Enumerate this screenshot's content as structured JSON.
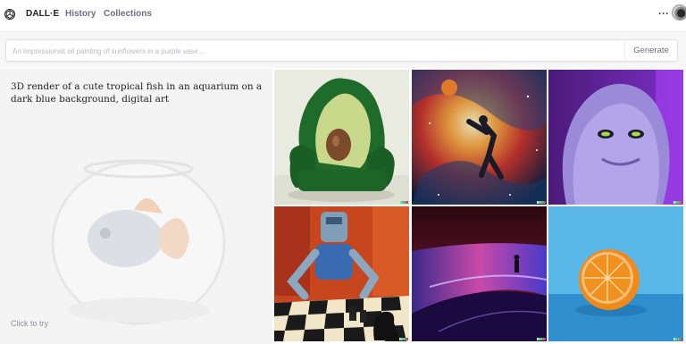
{
  "nav": {
    "brand": "DALL·E",
    "links": [
      "History",
      "Collections"
    ],
    "more": "···"
  },
  "search": {
    "placeholder": "An Impressionist oil painting of sunflowers in a purple vase…",
    "value": "",
    "button": "Generate"
  },
  "showcase": {
    "prompt": "3D render of a cute tropical fish in an aquarium on a dark blue background, digital art",
    "cta": "Click to try"
  },
  "colors": {
    "text": "#202123",
    "muted": "#6e6e80",
    "border": "#ececf1",
    "panel": "#f4f4f5"
  },
  "grid": [
    {
      "name": "avocado-armchair-image",
      "subject": "green avocado armchair"
    },
    {
      "name": "cosmic-basketball-image",
      "subject": "basketball player dunking in a nebula"
    },
    {
      "name": "purple-monster-image",
      "subject": "fluffy purple monster"
    },
    {
      "name": "robot-chess-image",
      "subject": "robot playing chess painting"
    },
    {
      "name": "silhouette-dunes-image",
      "subject": "figure on glowing dunes"
    },
    {
      "name": "orange-half-image",
      "subject": "half orange on blue"
    }
  ]
}
